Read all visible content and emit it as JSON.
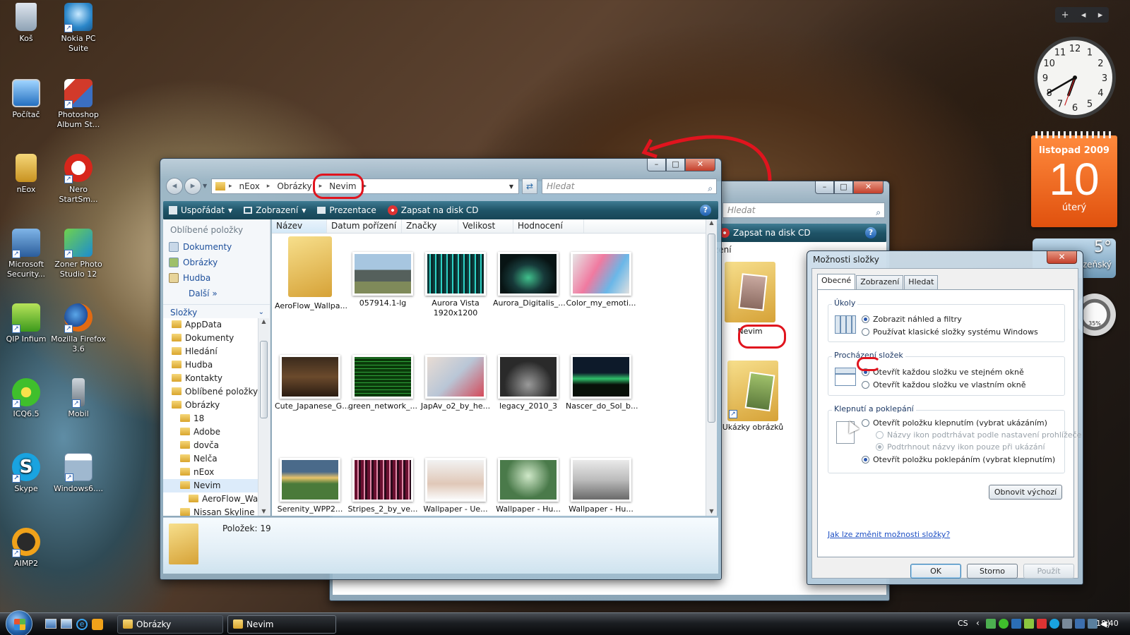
{
  "desktop": {
    "icons": [
      {
        "label": "Koš"
      },
      {
        "label": "Nokia PC Suite"
      },
      {
        "label": "Počítač"
      },
      {
        "label": "Photoshop Album St..."
      },
      {
        "label": "nEox"
      },
      {
        "label": "Nero StartSm..."
      },
      {
        "label": "Microsoft Security..."
      },
      {
        "label": "Zoner Photo Studio 12"
      },
      {
        "label": "QIP Infium"
      },
      {
        "label": "Mozilla Firefox 3.6"
      },
      {
        "label": "ICQ6.5"
      },
      {
        "label": "Mobil"
      },
      {
        "label": "Skype"
      },
      {
        "label": "Windows6...."
      },
      {
        "label": "AIMP2"
      }
    ]
  },
  "gadgets": {
    "calendar": {
      "month": "listopad 2009",
      "day": "10",
      "weekday": "úterý"
    },
    "weather": {
      "temp": "5°",
      "city": "Plzeňský"
    },
    "cpu": {
      "percent": "35%"
    },
    "clock": {
      "hour": 6,
      "minute": 40
    }
  },
  "explorer": {
    "breadcrumb": [
      "nEox",
      "Obrázky",
      "Nevim"
    ],
    "search_placeholder": "Hledat",
    "toolbar": {
      "organize": "Uspořádat",
      "views": "Zobrazení",
      "slideshow": "Prezentace",
      "burn": "Zapsat na disk CD"
    },
    "favorites_title": "Oblíbené položky",
    "favorites": [
      "Dokumenty",
      "Obrázky",
      "Hudba"
    ],
    "more": "Další",
    "folders_title": "Složky",
    "tree": [
      {
        "label": "AppData",
        "level": 0
      },
      {
        "label": "Dokumenty",
        "level": 0
      },
      {
        "label": "Hledání",
        "level": 0
      },
      {
        "label": "Hudba",
        "level": 0
      },
      {
        "label": "Kontakty",
        "level": 0
      },
      {
        "label": "Oblíbené položky",
        "level": 0
      },
      {
        "label": "Obrázky",
        "level": 0
      },
      {
        "label": "18",
        "level": 1
      },
      {
        "label": "Adobe",
        "level": 1
      },
      {
        "label": "dovča",
        "level": 1
      },
      {
        "label": "Nelča",
        "level": 1
      },
      {
        "label": "nEox",
        "level": 1
      },
      {
        "label": "Nevim",
        "level": 1
      },
      {
        "label": "AeroFlow_Wall",
        "level": 2
      },
      {
        "label": "Nissan Skyline",
        "level": 1
      }
    ],
    "columns": [
      "Název",
      "Datum pořízení",
      "Značky",
      "Velikost",
      "Hodnocení"
    ],
    "files": [
      {
        "name": "AeroFlow_Wallpa...",
        "kind": "folder"
      },
      {
        "name": "057914.1-lg",
        "kind": "car"
      },
      {
        "name": "Aurora Vista 1920x1200",
        "kind": "aurora-teal"
      },
      {
        "name": "Aurora_Digitalis_...",
        "kind": "aurora-dark"
      },
      {
        "name": "Color_my_emoti...",
        "kind": "colors"
      },
      {
        "name": "Cute_Japanese_G...",
        "kind": "photos"
      },
      {
        "name": "green_network_...",
        "kind": "green"
      },
      {
        "name": "JapAv_o2_by_he...",
        "kind": "girl"
      },
      {
        "name": "legacy_2010_3",
        "kind": "interior"
      },
      {
        "name": "Nascer_do_Sol_b...",
        "kind": "sunrise"
      },
      {
        "name": "Serenity_WPP2...",
        "kind": "serenity"
      },
      {
        "name": "Stripes_2_by_ve...",
        "kind": "stripes"
      },
      {
        "name": "Wallpaper - Ue...",
        "kind": "girl2"
      },
      {
        "name": "Wallpaper - Hu...",
        "kind": "girl3"
      },
      {
        "name": "Wallpaper - Hu...",
        "kind": "girl4"
      }
    ],
    "status": "Položek: 19"
  },
  "explorer2": {
    "search_placeholder": "Hledat",
    "burn": "Zapsat na disk CD",
    "column_partial": "zení",
    "items": [
      {
        "name": "Nevim"
      },
      {
        "name": "Ukázky obrázků"
      }
    ]
  },
  "dialog": {
    "title": "Možnosti složky",
    "tabs": [
      "Obecné",
      "Zobrazení",
      "Hledat"
    ],
    "tasks": {
      "title": "Úkoly",
      "opt1": "Zobrazit náhled a filtry",
      "opt2": "Používat klasické složky systému Windows"
    },
    "browse": {
      "title": "Procházení složek",
      "opt1": "Otevřít každou složku ve stejném okně",
      "opt2": "Otevřít každou složku ve vlastním okně"
    },
    "click": {
      "title": "Klepnutí a poklepání",
      "opt1": "Otevřít položku klepnutím (vybrat ukázáním)",
      "sub1": "Názvy ikon podtrhávat podle nastavení prohlížeče",
      "sub2": "Podtrhnout názvy ikon pouze při ukázání",
      "opt2": "Otevřít položku poklepáním (vybrat klepnutím)"
    },
    "restore": "Obnovit výchozí",
    "help_link": "Jak lze změnit možnosti složky?",
    "ok": "OK",
    "cancel": "Storno",
    "apply": "Použít"
  },
  "taskbar": {
    "buttons": [
      "Obrázky",
      "Nevim"
    ],
    "lang": "CS",
    "time": "18:40"
  },
  "colors": {
    "toolbar": "#1f5468",
    "annotation": "#e0141e",
    "link": "#1d4f9b"
  }
}
